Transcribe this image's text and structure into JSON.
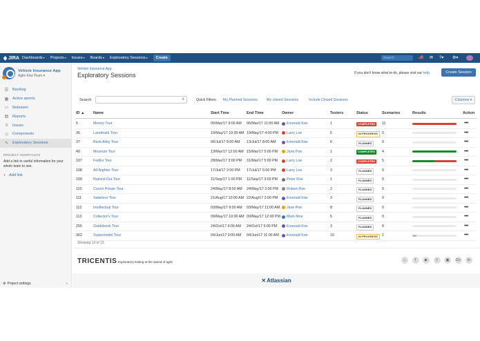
{
  "topbar": {
    "logo_text": "JIRA",
    "nav": [
      {
        "label": "Dashboards"
      },
      {
        "label": "Projects"
      },
      {
        "label": "Issues"
      },
      {
        "label": "Boards"
      },
      {
        "label": "Exploratory Sessions"
      }
    ],
    "create_label": "Create",
    "search_placeholder": "Search"
  },
  "sidebar": {
    "project_name": "Vehicle Insurance App",
    "team": "Agile Kiwi Team ▾",
    "items": [
      {
        "label": "Backlog",
        "icon": "backlog-icon",
        "glyph": "☰"
      },
      {
        "label": "Active sprints",
        "icon": "sprints-icon",
        "glyph": "▦"
      },
      {
        "label": "Releases",
        "icon": "releases-icon",
        "glyph": "▭"
      },
      {
        "label": "Reports",
        "icon": "reports-icon",
        "glyph": "▤"
      },
      {
        "label": "Issues",
        "icon": "issues-icon",
        "glyph": "≡"
      },
      {
        "label": "Components",
        "icon": "components-icon",
        "glyph": "◇"
      },
      {
        "label": "Exploratory Sessions",
        "icon": "exploratory-icon",
        "glyph": "✎"
      }
    ],
    "shortcuts_heading": "PROJECT SHORTCUTS",
    "shortcuts_desc": "Add a link to useful information for your whole team to see.",
    "add_link": "Add link",
    "settings": "Project settings"
  },
  "page": {
    "breadcrumb": "Vehicle Insurance App",
    "title": "Exploratory Sessions",
    "help_text": "If you don't know what to do, please visit our",
    "help_link": "help",
    "create_session": "Create Session",
    "search_label": "Search",
    "quick_filters_label": "Quick Filters",
    "quick_filters": [
      "My Planned Sessions",
      "My Joined Sessions",
      "Include Closed Sessions"
    ],
    "columns_button": "Columns ▾",
    "showing": "Showing 13 of 13"
  },
  "table": {
    "headers": [
      "ID ▲",
      "Name",
      "Start Time",
      "End Time",
      "Owner",
      "Testers",
      "Status",
      "Scenarios",
      "Results",
      "Action"
    ],
    "rows": [
      {
        "id": "5",
        "name": "Money Tour",
        "start": "06/Mar/17 9:00 AM",
        "end": "06/Mar/17 11:00 AM",
        "owner": "Emerald Koe",
        "testers": "1",
        "status": "COMPLETED",
        "scenarios": "11",
        "results": {
          "green": 0,
          "red": 1.0
        }
      },
      {
        "id": "36",
        "name": "Landmark Tour",
        "start": "19/May/17 10:00 AM",
        "end": "19/May/17 4:00 PM",
        "owner": "Larry Loe",
        "testers": "5",
        "status": "IN PROGRESS",
        "scenarios": "0",
        "results": {
          "green": 0,
          "red": 0
        }
      },
      {
        "id": "37",
        "name": "Back Alley Tour",
        "start": "06/Jul/17 8:00 AM",
        "end": "13/Jul/17 8:00 AM",
        "owner": "Emerald Koe",
        "testers": "6",
        "status": "PLANNED",
        "scenarios": "0",
        "results": {
          "green": 0,
          "red": 0
        }
      },
      {
        "id": "40",
        "name": "Museum Tour",
        "start": "13/Mar/17 12:00 AM",
        "end": "15/Mar/17 5:00 PM",
        "owner": "Jane Poe",
        "testers": "1",
        "status": "COMPLETED",
        "scenarios": "4",
        "results": {
          "green": 1.0,
          "red": 0
        }
      },
      {
        "id": "107",
        "name": "FedEx Tour",
        "start": "28/Mar/17 3:00 PM",
        "end": "31/Mar/17 5:00 PM",
        "owner": "Larry Loe",
        "testers": "2",
        "status": "COMPLETED",
        "scenarios": "5",
        "results": {
          "green": 0.5,
          "red": 0.5
        }
      },
      {
        "id": "108",
        "name": "All-Nighter Tour",
        "start": "17/Jul/17 2:00 PM",
        "end": "17/Jul/17 5:00 PM",
        "owner": "Larry Loe",
        "testers": "3",
        "status": "PLANNED",
        "scenarios": "0",
        "results": {
          "green": 0,
          "red": 0
        }
      },
      {
        "id": "109",
        "name": "Rained-Out Tour",
        "start": "11/Sep/17 1:00 PM",
        "end": "11/Sep/17 3:00 PM",
        "owner": "Peter Roe",
        "testers": "1",
        "status": "PLANNED",
        "scenarios": "0",
        "results": {
          "green": 0,
          "red": 0
        }
      },
      {
        "id": "110",
        "name": "Couch Potato Tour",
        "start": "24/May/17 8:00 AM",
        "end": "24/May/17 2:00 PM",
        "owner": "Robert Roe",
        "testers": "2",
        "status": "PLANNED",
        "scenarios": "0",
        "results": {
          "green": 0,
          "red": 0
        }
      },
      {
        "id": "111",
        "name": "Saboteur Tour",
        "start": "21/Aug/17 10:00 AM",
        "end": "22/Aug/17 2:00 PM",
        "owner": "Emerald Koe",
        "testers": "3",
        "status": "PLANNED",
        "scenarios": "0",
        "results": {
          "green": 0,
          "red": 0
        }
      },
      {
        "id": "112",
        "name": "Intellectual Tour",
        "start": "03/May/17 9:00 AM",
        "end": "03/May/17 11:00 AM",
        "owner": "Jane Poe",
        "testers": "8",
        "status": "PLANNED",
        "scenarios": "0",
        "results": {
          "green": 0,
          "red": 0
        }
      },
      {
        "id": "113",
        "name": "Collector's Tour",
        "start": "09/May/17 10:00 AM",
        "end": "09/May/17 12:00 PM",
        "owner": "Mark Moe",
        "testers": "5",
        "status": "PLANNED",
        "scenarios": "0",
        "results": {
          "green": 0,
          "red": 0
        }
      },
      {
        "id": "255",
        "name": "Guidebook Tour",
        "start": "24/Oct/17 9:00 AM",
        "end": "24/Oct/17 5:00 PM",
        "owner": "Emerald Koe",
        "testers": "3",
        "status": "PLANNED",
        "scenarios": "0",
        "results": {
          "green": 0,
          "red": 0
        }
      },
      {
        "id": "362",
        "name": "Supermodel Tour",
        "start": "04/Jun/17 9:00 AM",
        "end": "04/Jun/17 11:00 AM",
        "owner": "Emerald Koe",
        "testers": "10",
        "status": "IN PROGRESS",
        "scenarios": "1",
        "results": {
          "green": 0,
          "red": 0,
          "grey": 0.1
        }
      }
    ]
  },
  "owner_colors": {
    "Emerald Koe": "#6554c0",
    "Larry Loe": "#d04437",
    "Jane Poe": "#e3a500",
    "Peter Roe": "#707070",
    "Robert Roe": "#888888",
    "Mark Moe": "#3b73af"
  },
  "footer": {
    "brand": "TRICENTIS",
    "tagline": "Exploratory testing at the speed of agile",
    "social": [
      "home-icon",
      "facebook-icon",
      "youtube-icon",
      "twitter-icon",
      "slideshare-icon",
      "googleplus-icon",
      "linkedin-icon"
    ],
    "social_glyphs": [
      "⌂",
      "f",
      "▶",
      "t",
      "▣",
      "G+",
      "in"
    ],
    "atlassian": "Atlassian"
  },
  "colors": {
    "header": "#205081",
    "link": "#3b73af",
    "completed_red": "#d04437",
    "completed_green": "#14892c"
  }
}
